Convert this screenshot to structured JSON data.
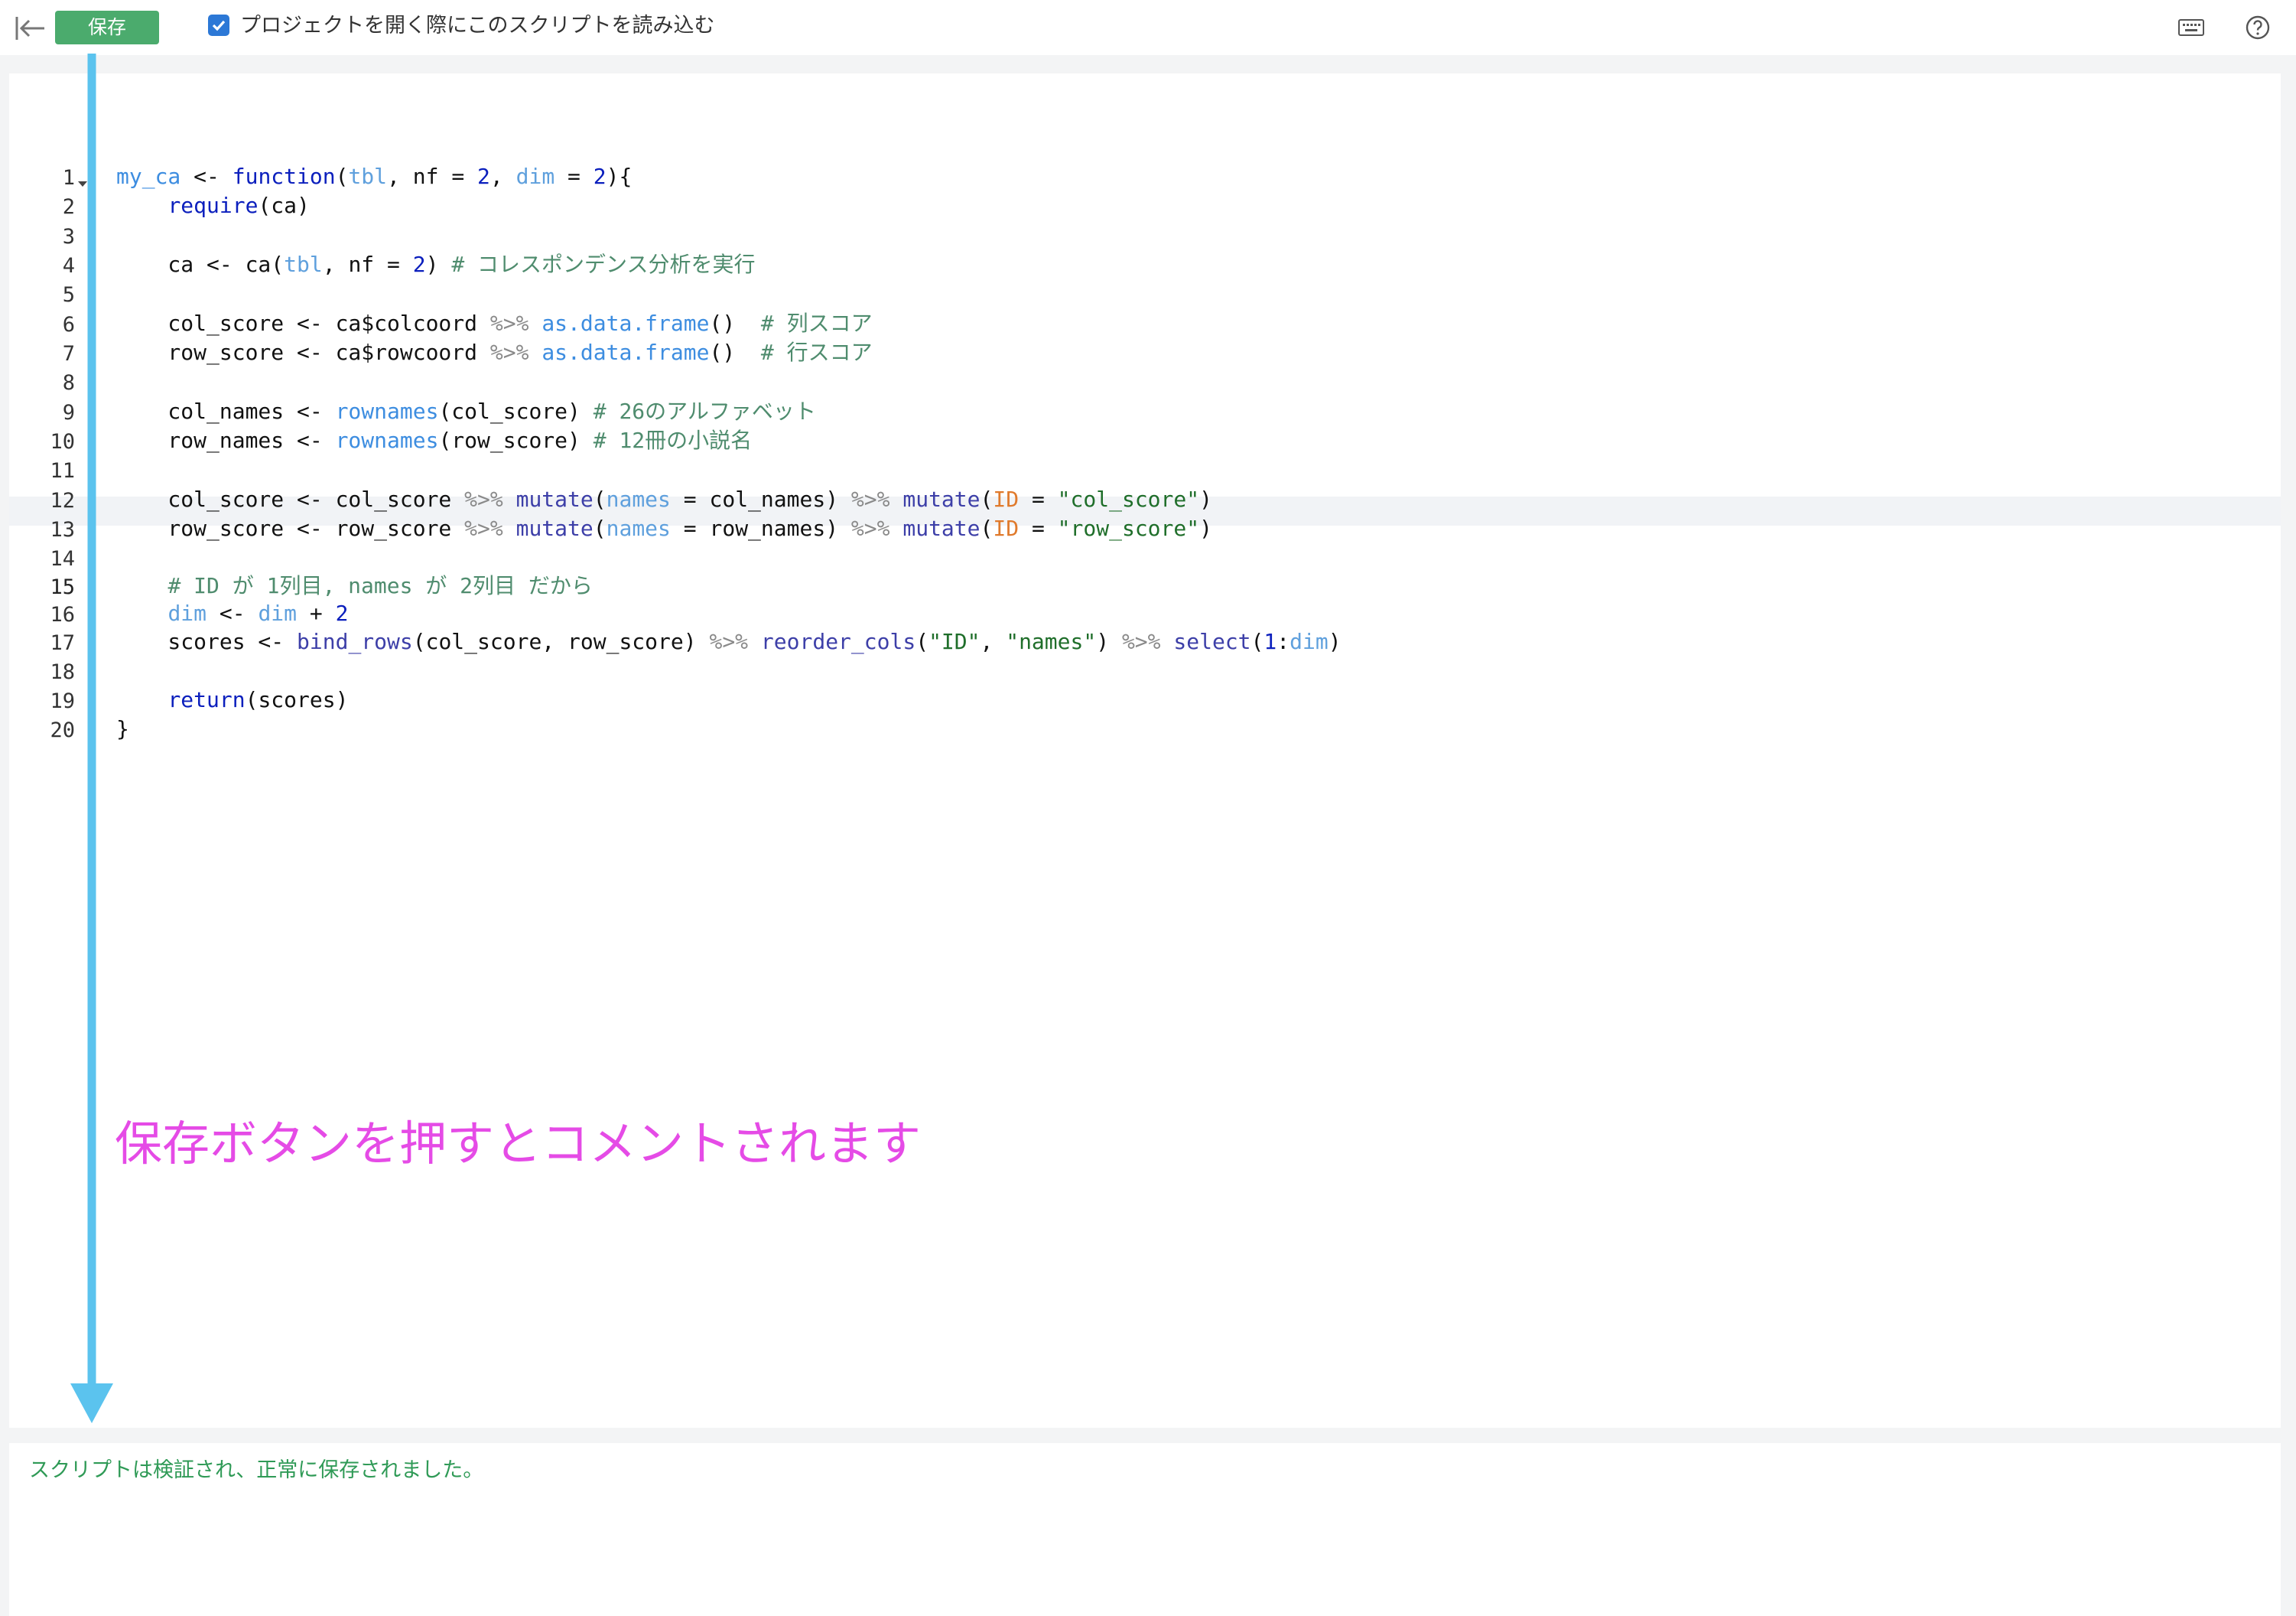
{
  "toolbar": {
    "save_label": "保存",
    "autoload_checked": true,
    "autoload_label": "プロジェクトを開く際にこのスクリプトを読み込む",
    "keyboard_icon": "keyboard-icon",
    "help_icon": "help-icon",
    "collapse_icon": "collapse-left-icon"
  },
  "editor": {
    "active_line": 15,
    "line_numbers": [
      "1",
      "2",
      "3",
      "4",
      "5",
      "6",
      "7",
      "8",
      "9",
      "10",
      "11",
      "12",
      "13",
      "14",
      "15",
      "16",
      "17",
      "18",
      "19",
      "20"
    ],
    "lines": [
      "my_ca <- function(tbl, nf = 2, dim = 2){",
      "    require(ca)",
      "",
      "    ca <- ca(tbl, nf = 2) # コレスポンデンス分析を実行",
      "",
      "    col_score <- ca$colcoord %>% as.data.frame()  # 列スコア",
      "    row_score <- ca$rowcoord %>% as.data.frame()  # 行スコア",
      "",
      "    col_names <- rownames(col_score) # 26のアルファベット",
      "    row_names <- rownames(row_score) # 12冊の小説名",
      "",
      "    col_score <- col_score %>% mutate(names = col_names) %>% mutate(ID = \"col_score\")",
      "    row_score <- row_score %>% mutate(names = row_names) %>% mutate(ID = \"row_score\")",
      "",
      "    # ID が 1列目, names が 2列目 だから",
      "    dim <- dim + 2",
      "    scores <- bind_rows(col_score, row_score) %>% reorder_cols(\"ID\", \"names\") %>% select(1:dim)",
      "",
      "    return(scores)",
      "}"
    ]
  },
  "annotation": {
    "text": "保存ボタンを押すとコメントされます",
    "color": "#e54be6",
    "arrow_color": "#5bc3ee"
  },
  "console": {
    "status": "スクリプトは検証され、正常に保存されました。"
  },
  "colors": {
    "save_button": "#4bab6d",
    "status_text": "#2f9a56"
  }
}
